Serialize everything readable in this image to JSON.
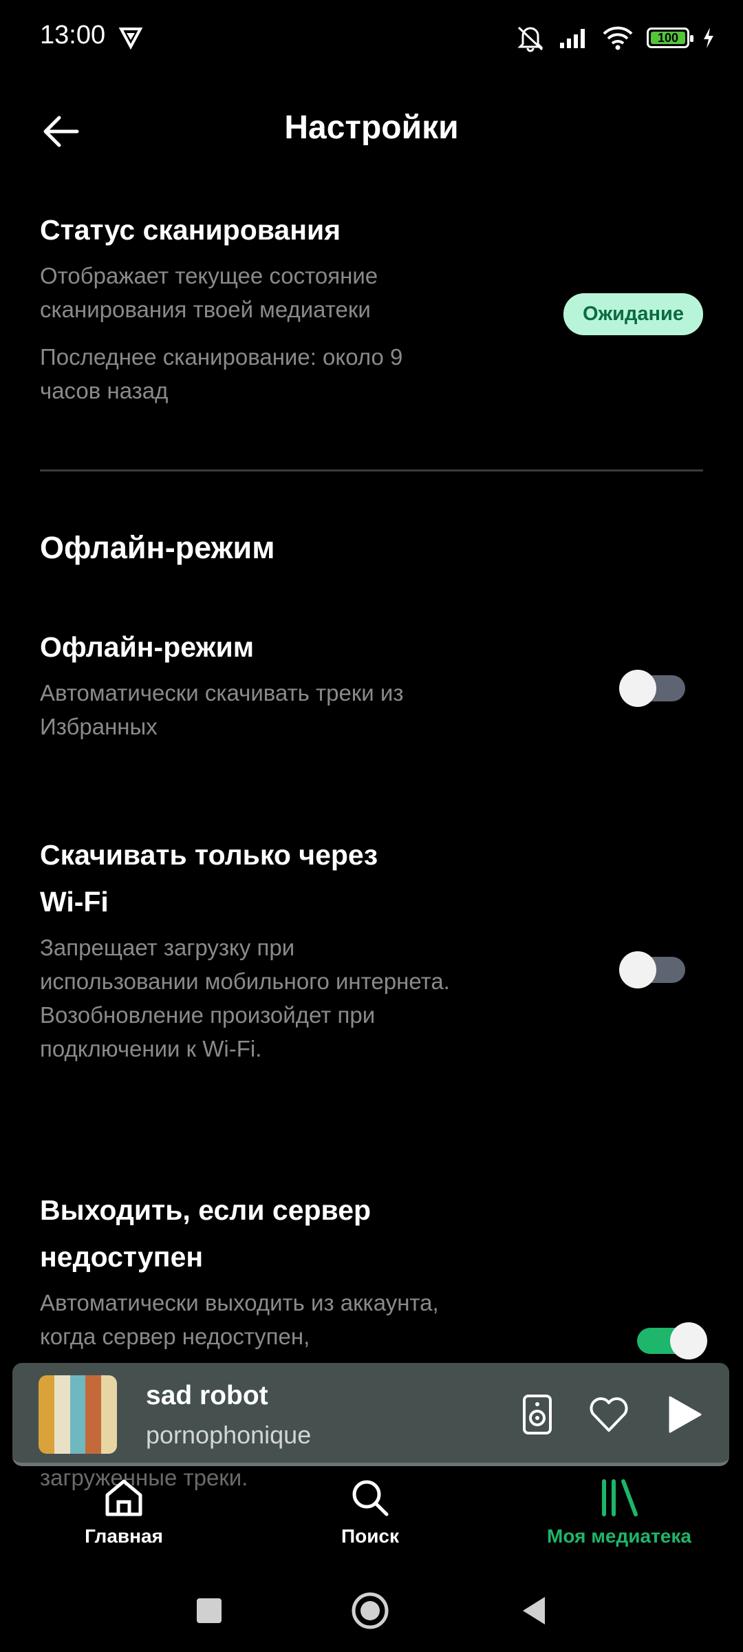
{
  "status_bar": {
    "time": "13:00",
    "battery": "100"
  },
  "header": {
    "title": "Настройки"
  },
  "scan_status": {
    "title": "Статус сканирования",
    "description": "Отображает текущее состояние сканирования твоей медиатеки",
    "last_scan": "Последнее сканирование: около 9 часов назад",
    "badge": "Ожидание"
  },
  "offline_section": {
    "heading": "Офлайн-режим"
  },
  "settings": [
    {
      "title": "Офлайн-режим",
      "description": "Автоматически скачивать треки из Избранных",
      "enabled": false
    },
    {
      "title": "Скачивать только через Wi-Fi",
      "description": "Запрещает загрузку при использовании мобильного интернета. Возобновление произойдет при подключении к Wi-Fi.",
      "enabled": false
    },
    {
      "title": "Выходить, если сервер недоступен",
      "description": "Автоматически выходить из аккаунта, когда сервер недоступен,",
      "enabled": true
    }
  ],
  "peek_text": "загруженные треки.",
  "player": {
    "title": "sad robot",
    "artist": "pornophonique"
  },
  "nav": [
    {
      "label": "Главная",
      "icon": "home-icon",
      "active": false
    },
    {
      "label": "Поиск",
      "icon": "search-icon",
      "active": false
    },
    {
      "label": "Моя медиатека",
      "icon": "library-icon",
      "active": true
    }
  ],
  "colors": {
    "accent": "#1db66a",
    "badge_bg": "#b8f5d8",
    "player_bg": "#46504f"
  }
}
